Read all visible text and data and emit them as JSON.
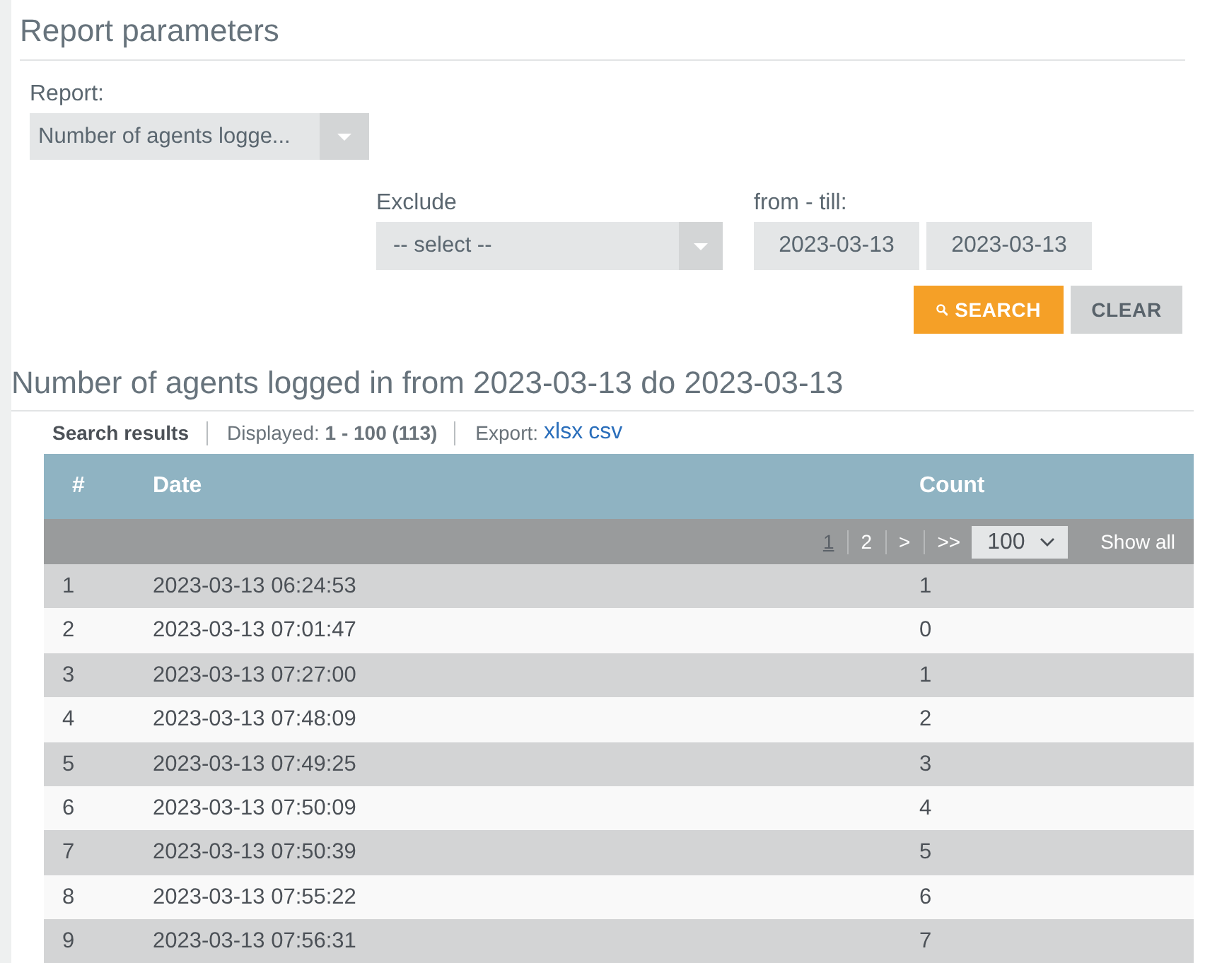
{
  "section_title": "Report parameters",
  "report_field": {
    "label": "Report:",
    "value": "Number of agents logge..."
  },
  "exclude_field": {
    "label": "Exclude",
    "value": "-- select --"
  },
  "date_range": {
    "label": "from - till:",
    "from": "2023-03-13",
    "till": "2023-03-13"
  },
  "buttons": [
    {
      "label": "SEARCH",
      "kind": "search"
    },
    {
      "label": "CLEAR",
      "kind": "clear"
    }
  ],
  "results_title": "Number of agents logged in from 2023-03-13 do 2023-03-13",
  "summary": {
    "title": "Search results",
    "displayed": "Displayed: **1 - 100 (113)**",
    "export_label": "Export:",
    "export_links": [
      "xlsx",
      "csv"
    ]
  },
  "table": {
    "columns": [
      "#",
      "Date",
      "Count"
    ],
    "pagination": {
      "pages": [
        {
          "label": "1",
          "selected": true
        },
        {
          "label": "2",
          "selected": false
        }
      ],
      "next": ">",
      "last": ">>",
      "page_size": "100",
      "show_all": "Show all"
    },
    "rows": [
      [
        "1",
        "2023-03-13 06:24:53",
        "1"
      ],
      [
        "2",
        "2023-03-13 07:01:47",
        "0"
      ],
      [
        "3",
        "2023-03-13 07:27:00",
        "1"
      ],
      [
        "4",
        "2023-03-13 07:48:09",
        "2"
      ],
      [
        "5",
        "2023-03-13 07:49:25",
        "3"
      ],
      [
        "6",
        "2023-03-13 07:50:09",
        "4"
      ],
      [
        "7",
        "2023-03-13 07:50:39",
        "5"
      ],
      [
        "8",
        "2023-03-13 07:55:22",
        "6"
      ],
      [
        "9",
        "2023-03-13 07:56:31",
        "7"
      ]
    ]
  }
}
